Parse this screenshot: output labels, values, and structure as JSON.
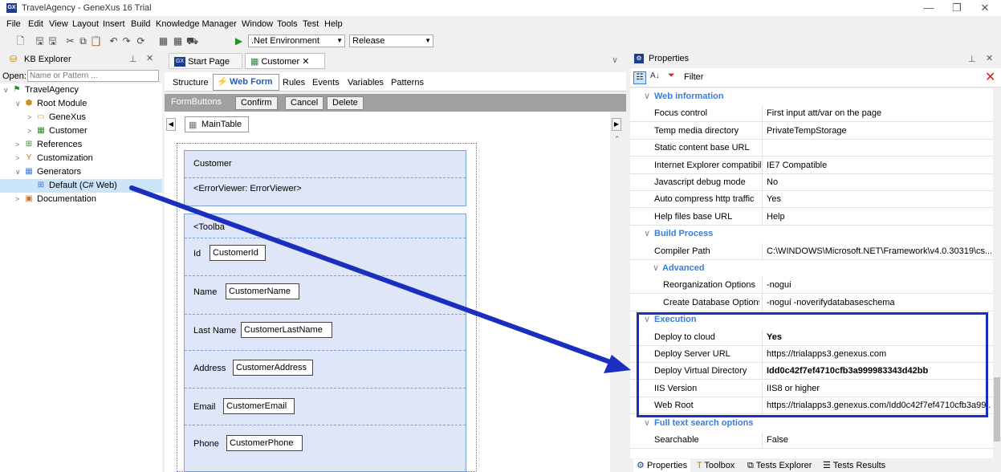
{
  "window": {
    "title": "TravelAgency - GeneXus 16 Trial",
    "app_icon": "GX",
    "minimize": "—",
    "maximize": "❐",
    "close": "✕"
  },
  "menu": [
    "File",
    "Edit",
    "View",
    "Layout",
    "Insert",
    "Build",
    "Knowledge Manager",
    "Window",
    "Tools",
    "Test",
    "Help"
  ],
  "toolbar": {
    "environment": ".Net Environment",
    "configuration": "Release"
  },
  "kb_explorer": {
    "title": "KB Explorer",
    "open_label": "Open:",
    "open_placeholder": "Name or Pattern ...",
    "tree": [
      {
        "label": "TravelAgency",
        "level": 0,
        "exp": "∨",
        "icon": "kb-icon"
      },
      {
        "label": "Root Module",
        "level": 1,
        "exp": "∨",
        "icon": "module-icon"
      },
      {
        "label": "GeneXus",
        "level": 2,
        "exp": ">",
        "icon": "folder-icon"
      },
      {
        "label": "Customer",
        "level": 2,
        "exp": ">",
        "icon": "transaction-icon"
      },
      {
        "label": "References",
        "level": 1,
        "exp": ">",
        "icon": "references-icon"
      },
      {
        "label": "Customization",
        "level": 1,
        "exp": ">",
        "icon": "customization-icon"
      },
      {
        "label": "Generators",
        "level": 1,
        "exp": "∨",
        "icon": "generators-icon"
      },
      {
        "label": "Default (C# Web)",
        "level": 2,
        "exp": "",
        "icon": "generator-icon",
        "selected": true
      },
      {
        "label": "Documentation",
        "level": 1,
        "exp": ">",
        "icon": "documentation-icon"
      }
    ]
  },
  "editor": {
    "tabs": [
      {
        "label": "Start Page",
        "close": "✕"
      },
      {
        "label": "Customer",
        "close": "✕",
        "active": true
      }
    ],
    "subtabs": [
      "Structure",
      "Web Form",
      "Rules",
      "Events",
      "Variables",
      "Patterns"
    ],
    "active_subtab": "Web Form",
    "form_buttons_label": "FormButtons",
    "buttons": [
      "Confirm",
      "Cancel",
      "Delete"
    ],
    "main_table": "MainTable",
    "form": {
      "title": "Customer",
      "error_viewer": "<ErrorViewer: ErrorViewer>",
      "toolbar_stub": "<Toolba",
      "fields": [
        {
          "label": "Id",
          "value": "CustomerId"
        },
        {
          "label": "Name",
          "value": "CustomerName"
        },
        {
          "label": "Last Name",
          "value": "CustomerLastName"
        },
        {
          "label": "Address",
          "value": "CustomerAddress"
        },
        {
          "label": "Email",
          "value": "CustomerEmail"
        },
        {
          "label": "Phone",
          "value": "CustomerPhone"
        }
      ]
    }
  },
  "properties": {
    "title": "Properties",
    "filter_label": "Filter",
    "rows": [
      {
        "type": "cat",
        "label": "Web information"
      },
      {
        "type": "prop",
        "key": "Focus control",
        "value": "First input att/var on the page"
      },
      {
        "type": "prop",
        "key": "Temp media directory",
        "value": "PrivateTempStorage"
      },
      {
        "type": "prop",
        "key": "Static content base URL",
        "value": ""
      },
      {
        "type": "prop",
        "key": "Internet Explorer compatibili",
        "value": "IE7 Compatible"
      },
      {
        "type": "prop",
        "key": "Javascript debug mode",
        "value": "No"
      },
      {
        "type": "prop",
        "key": "Auto compress http traffic",
        "value": "Yes"
      },
      {
        "type": "prop",
        "key": "Help files base URL",
        "value": "Help"
      },
      {
        "type": "cat",
        "label": "Build Process"
      },
      {
        "type": "prop",
        "key": "Compiler Path",
        "value": "C:\\WINDOWS\\Microsoft.NET\\Framework\\v4.0.30319\\cs..."
      },
      {
        "type": "subcat",
        "label": "Advanced"
      },
      {
        "type": "subprop",
        "key": "Reorganization Options",
        "value": "-nogui"
      },
      {
        "type": "subprop",
        "key": "Create Database Options",
        "value": "-nogui -noverifydatabaseschema"
      },
      {
        "type": "cat",
        "label": "Execution"
      },
      {
        "type": "prop",
        "key": "Deploy to cloud",
        "value": "Yes",
        "bold": true
      },
      {
        "type": "prop",
        "key": "Deploy Server URL",
        "value": "https://trialapps3.genexus.com"
      },
      {
        "type": "prop",
        "key": "Deploy Virtual Directory",
        "value": "Idd0c42f7ef4710cfb3a999983343d42bb",
        "bold": true
      },
      {
        "type": "prop",
        "key": "IIS Version",
        "value": "IIS8 or higher"
      },
      {
        "type": "prop",
        "key": "Web Root",
        "value": "https://trialapps3.genexus.com/Idd0c42f7ef4710cfb3a99..."
      },
      {
        "type": "cat",
        "label": "Full text search options"
      },
      {
        "type": "prop",
        "key": "Searchable",
        "value": "False"
      }
    ],
    "bottom_tabs": [
      "Properties",
      "Toolbox",
      "Tests Explorer",
      "Tests Results"
    ]
  },
  "colors": {
    "highlight": "#1a2fbf",
    "category": "#3a7dd8",
    "selection": "#cce4f7"
  }
}
